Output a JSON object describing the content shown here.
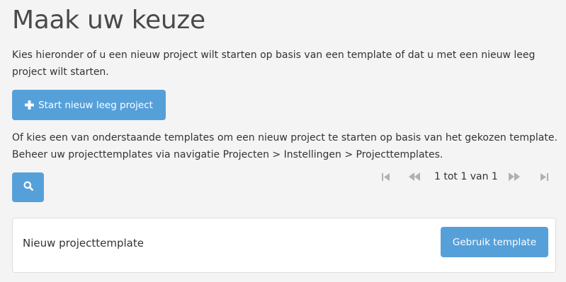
{
  "page": {
    "title": "Maak uw keuze",
    "intro": "Kies hieronder of u een nieuw project wilt starten op basis van een template of dat u met een nieuw leeg project wilt starten.",
    "start_button_label": "Start nieuw leeg project",
    "templates_text": "Of kies een van onderstaande templates om een nieuw project te starten op basis van het gekozen template. Beheer uw projecttemplates via navigatie Projecten > Instellingen > Projecttemplates."
  },
  "search": {
    "icon": "search-icon"
  },
  "pager": {
    "info": "1 tot 1 van 1",
    "icons": [
      "first-page-icon",
      "previous-page-icon",
      "next-page-icon",
      "last-page-icon"
    ]
  },
  "templates": [
    {
      "name": "Nieuw projecttemplate",
      "button_label": "Gebruik template"
    }
  ],
  "colors": {
    "accent": "#56a0da",
    "background": "#f4f4f4",
    "text": "#333333",
    "title": "#4a4a4a",
    "pager_disabled": "#b0b0b0"
  }
}
